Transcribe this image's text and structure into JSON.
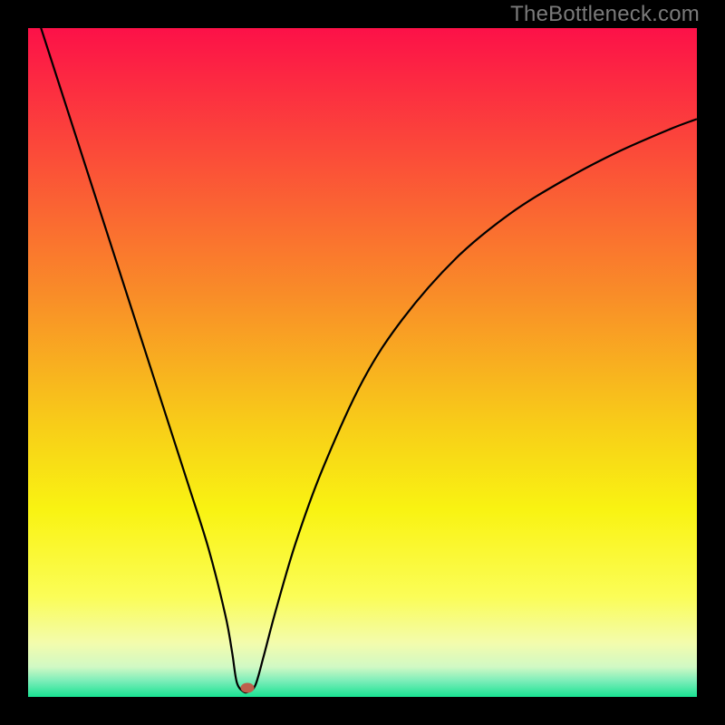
{
  "watermark": "TheBottleneck.com",
  "chart_data": {
    "type": "line",
    "title": "",
    "xlabel": "",
    "ylabel": "",
    "xlim": [
      0,
      1
    ],
    "ylim": [
      0,
      1
    ],
    "gradient": {
      "stops": [
        {
          "pos": 0.0,
          "color": "#fc1148"
        },
        {
          "pos": 0.2,
          "color": "#fb4f38"
        },
        {
          "pos": 0.4,
          "color": "#f98d28"
        },
        {
          "pos": 0.6,
          "color": "#f8cf18"
        },
        {
          "pos": 0.72,
          "color": "#f9f312"
        },
        {
          "pos": 0.85,
          "color": "#fbfd57"
        },
        {
          "pos": 0.92,
          "color": "#f3fcad"
        },
        {
          "pos": 0.955,
          "color": "#d1f9c4"
        },
        {
          "pos": 0.975,
          "color": "#80eeba"
        },
        {
          "pos": 1.0,
          "color": "#19e293"
        }
      ]
    },
    "series": [
      {
        "name": "bottleneck-curve",
        "x": [
          0.0,
          0.05,
          0.1,
          0.15,
          0.2,
          0.24,
          0.27,
          0.295,
          0.305,
          0.312,
          0.322,
          0.33,
          0.34,
          0.352,
          0.37,
          0.4,
          0.44,
          0.5,
          0.56,
          0.64,
          0.72,
          0.8,
          0.88,
          0.96,
          1.0
        ],
        "y": [
          1.06,
          0.905,
          0.75,
          0.595,
          0.44,
          0.316,
          0.221,
          0.122,
          0.067,
          0.022,
          0.008,
          0.008,
          0.018,
          0.06,
          0.128,
          0.23,
          0.34,
          0.472,
          0.565,
          0.656,
          0.722,
          0.772,
          0.814,
          0.849,
          0.864
        ]
      }
    ],
    "marker": {
      "x": 0.328,
      "y": 0.014,
      "color": "#be5f4c"
    }
  }
}
